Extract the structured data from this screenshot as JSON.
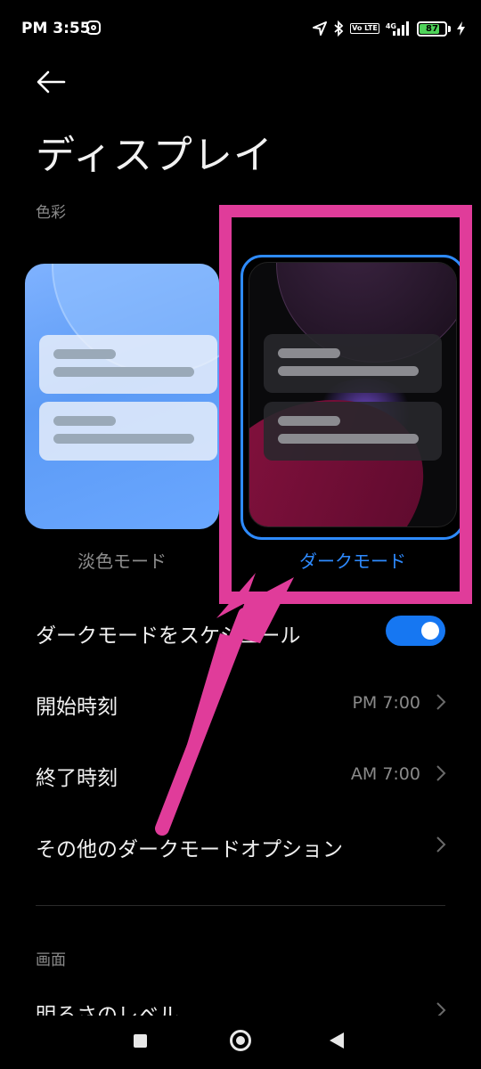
{
  "status_bar": {
    "time": "PM 3:55",
    "battery_level": "87",
    "network": "4G",
    "volte": "Vo LTE"
  },
  "header": {
    "title": "ディスプレイ"
  },
  "sections": {
    "color_label": "色彩",
    "screen_label": "画面"
  },
  "modes": {
    "light_label": "淡色モード",
    "dark_label": "ダークモード",
    "selected": "dark"
  },
  "settings": {
    "schedule_label": "ダークモードをスケジュール",
    "schedule_enabled": true,
    "start_label": "開始時刻",
    "start_value": "PM 7:00",
    "end_label": "終了時刻",
    "end_value": "AM 7:00",
    "options_label": "その他のダークモードオプション",
    "brightness_label": "明るさのレベル"
  },
  "colors": {
    "accent": "#2e8bff",
    "highlight": "#e03c9a",
    "toggle_on": "#1677f2"
  }
}
